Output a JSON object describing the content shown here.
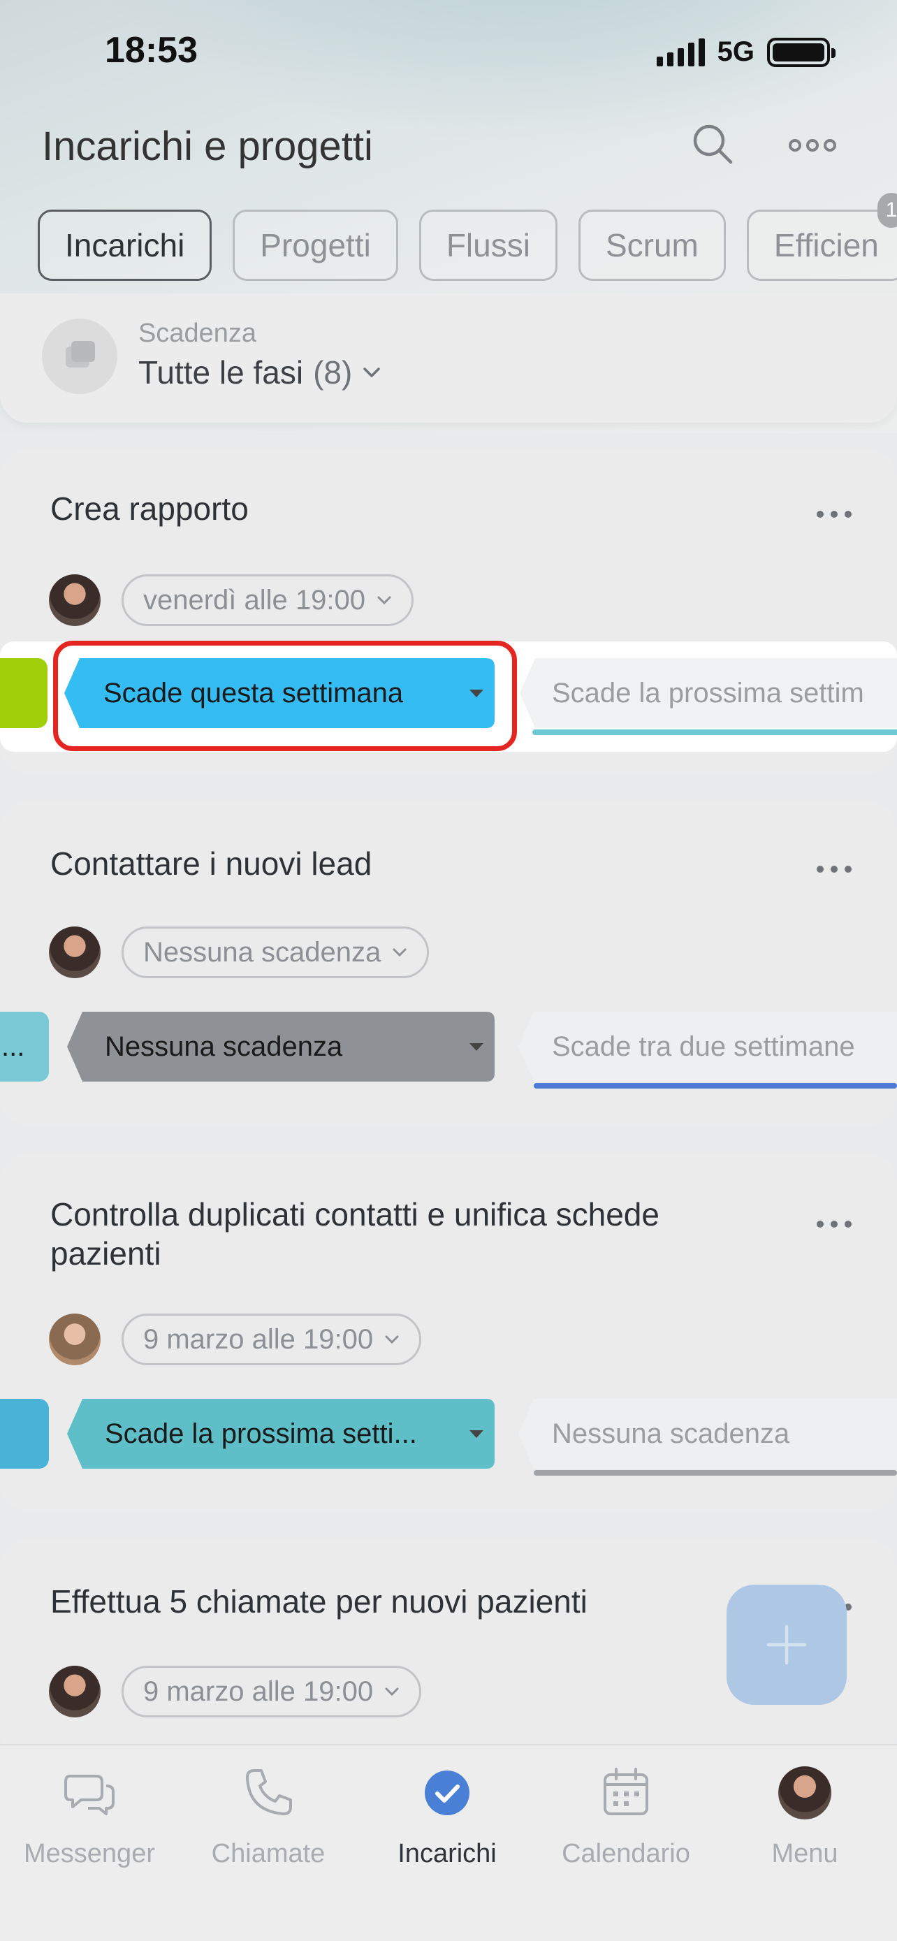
{
  "status_bar": {
    "time": "18:53",
    "network": "5G"
  },
  "header": {
    "title": "Incarichi e progetti"
  },
  "tabs": [
    {
      "label": "Incarichi",
      "active": true
    },
    {
      "label": "Progetti"
    },
    {
      "label": "Flussi"
    },
    {
      "label": "Scrum"
    },
    {
      "label": "Efficien"
    }
  ],
  "tab_badge": "1",
  "filter": {
    "label": "Scadenza",
    "value": "Tutte le fasi",
    "count": "(8)"
  },
  "tasks": [
    {
      "title": "Crea rapporto",
      "deadline": "venerdì alle 19:00",
      "current_stage": "Scade questa settimana",
      "next_stage": "Scade la prossima settim",
      "current_color": "#35bdf3",
      "prev_color": "#9fcf08",
      "next_color": "#6fc9d8"
    },
    {
      "title": "Contattare i nuovi lead",
      "deadline": "Nessuna scadenza",
      "prev_stage": "...",
      "current_stage": "Nessuna scadenza",
      "next_stage": "Scade tra due settimane",
      "current_color": "#8e9196",
      "prev_color": "#79cad4",
      "next_color": "#4f7bd6"
    },
    {
      "title": "Controlla duplicati contatti e unifica schede pazienti",
      "deadline": "9 marzo alle 19:00",
      "current_stage": "Scade la prossima setti...",
      "next_stage": "Nessuna scadenza",
      "current_color": "#5fbfc9",
      "prev_color": "#49b3d8",
      "next_color": "#9fa2a6"
    },
    {
      "title": "Effettua 5 chiamate per nuovi pazienti",
      "deadline": "9 marzo alle 19:00"
    }
  ],
  "bottom_nav": [
    {
      "label": "Messenger",
      "icon": "chat-icon"
    },
    {
      "label": "Chiamate",
      "icon": "phone-icon"
    },
    {
      "label": "Incarichi",
      "icon": "check-circle-icon",
      "active": true
    },
    {
      "label": "Calendario",
      "icon": "calendar-icon"
    },
    {
      "label": "Menu",
      "icon": "avatar-icon"
    }
  ],
  "colors": {
    "highlight": "#e52620",
    "fab": "#aec7e4",
    "active_tab_icon": "#4a7fd6"
  }
}
